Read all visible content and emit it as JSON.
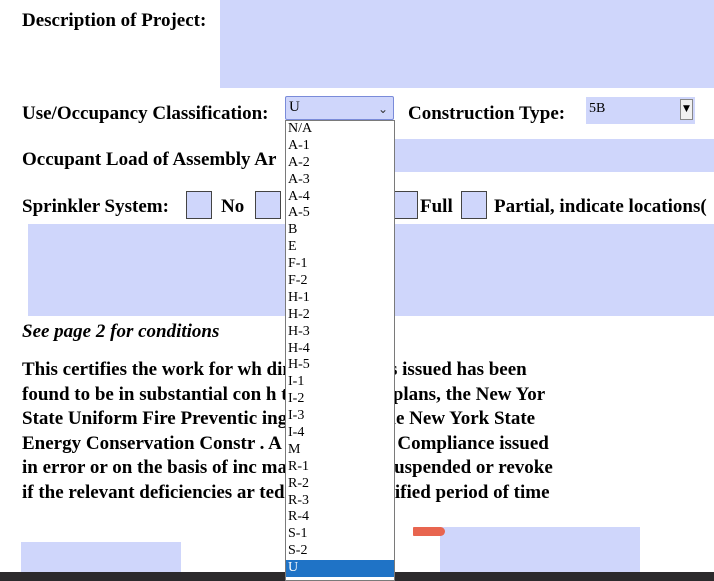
{
  "form": {
    "description_label": "Description of Project:",
    "use_label": "Use/Occupancy Classification:",
    "construction_label": "Construction Type:",
    "construction_value": "5B",
    "occupant_label": "Occupant Load of Assembly Ar",
    "sprinkler_label": "Sprinkler System:",
    "sprinkler_no": "No",
    "sprinkler_full": "Full",
    "sprinkler_partial": "Partial, indicate locations(",
    "conditions_note": "See page 2 for conditions",
    "certification_lines": [
      "This certifies the work for wh          ding permit was issued has been",
      "found to be in substantial con          h the approved plans, the New Yor",
      "State Uniform Fire Preventic          ing Code, and the New York State",
      "Energy Conservation Constr          . A Certificate of Compliance issued",
      "in error or on the basis of inc          mation may be suspended or revoke",
      "if the relevant deficiencies ar          ted within a specified period of time"
    ]
  },
  "dropdown": {
    "selected": "U",
    "options": [
      "N/A",
      "A-1",
      "A-2",
      "A-3",
      "A-4",
      "A-5",
      "B",
      "E",
      "F-1",
      "F-2",
      "H-1",
      "H-2",
      "H-3",
      "H-4",
      "H-5",
      "I-1",
      "I-2",
      "I-3",
      "I-4",
      "M",
      "R-1",
      "R-2",
      "R-3",
      "R-4",
      "S-1",
      "S-2",
      "U"
    ]
  },
  "colors": {
    "field": "#cfd6fb",
    "highlight": "#1f73c6"
  },
  "icons": {
    "dropdown": "chevron-down-icon",
    "select": "small-dropdown-arrow-icon"
  }
}
